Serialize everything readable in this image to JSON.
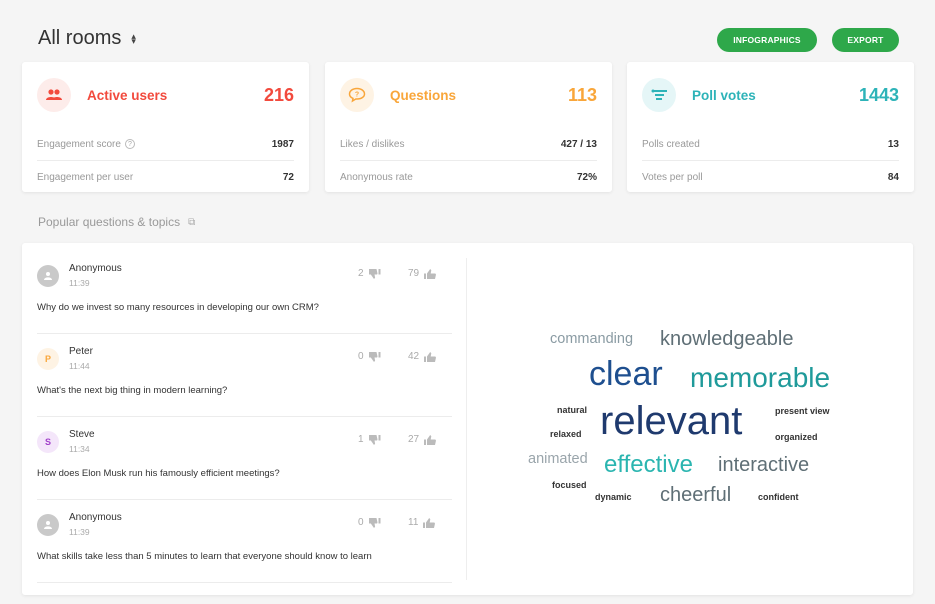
{
  "header": {
    "title": "All rooms",
    "buttons": {
      "infographics": "INFOGRAPHICS",
      "export": "EXPORT"
    }
  },
  "colors": {
    "red": "#f24a3d",
    "orange": "#f9a63a",
    "teal": "#2db3b8",
    "green": "#2ea84a"
  },
  "cards": [
    {
      "title": "Active users",
      "value": "216",
      "icon": "users-icon",
      "rows": [
        {
          "label": "Engagement score",
          "value": "1987",
          "help": true
        },
        {
          "label": "Engagement per user",
          "value": "72"
        }
      ]
    },
    {
      "title": "Questions",
      "value": "113",
      "icon": "question-bubble-icon",
      "rows": [
        {
          "label": "Likes / dislikes",
          "value": "427 / 13"
        },
        {
          "label": "Anonymous rate",
          "value": "72%"
        }
      ]
    },
    {
      "title": "Poll votes",
      "value": "1443",
      "icon": "poll-icon",
      "rows": [
        {
          "label": "Polls created",
          "value": "13"
        },
        {
          "label": "Votes per poll",
          "value": "84"
        }
      ]
    }
  ],
  "section": {
    "title": "Popular questions & topics"
  },
  "questions": [
    {
      "author": "Anonymous",
      "initial": "",
      "time": "11:39",
      "text": "Why do we invest so many resources in developing our own CRM?",
      "dislikes": "2",
      "likes": "79"
    },
    {
      "author": "Peter",
      "initial": "P",
      "time": "11:44",
      "text": "What's the next big thing in modern learning?",
      "dislikes": "0",
      "likes": "42"
    },
    {
      "author": "Steve",
      "initial": "S",
      "time": "11:34",
      "text": "How does Elon Musk run his famously efficient meetings?",
      "dislikes": "1",
      "likes": "27"
    },
    {
      "author": "Anonymous",
      "initial": "",
      "time": "11:39",
      "text": "What skills take less than 5 minutes to learn that everyone should know to learn",
      "dislikes": "0",
      "likes": "11"
    }
  ],
  "word_cloud": [
    {
      "word": "commanding",
      "color": "#8a9ba3"
    },
    {
      "word": "knowledgeable",
      "color": "#5f6f76"
    },
    {
      "word": "clear",
      "color": "#1e4f8f"
    },
    {
      "word": "memorable",
      "color": "#1f9a9a"
    },
    {
      "word": "natural",
      "color": "#333333"
    },
    {
      "word": "relevant",
      "color": "#1f3a6e"
    },
    {
      "word": "present view",
      "color": "#333333"
    },
    {
      "word": "relaxed",
      "color": "#333333"
    },
    {
      "word": "organized",
      "color": "#333333"
    },
    {
      "word": "animated",
      "color": "#9aa5ab"
    },
    {
      "word": "effective",
      "color": "#2bb5b0"
    },
    {
      "word": "interactive",
      "color": "#5f6f76"
    },
    {
      "word": "focused",
      "color": "#333333"
    },
    {
      "word": "dynamic",
      "color": "#333333"
    },
    {
      "word": "cheerful",
      "color": "#5f6f76"
    },
    {
      "word": "confident",
      "color": "#333333"
    }
  ]
}
